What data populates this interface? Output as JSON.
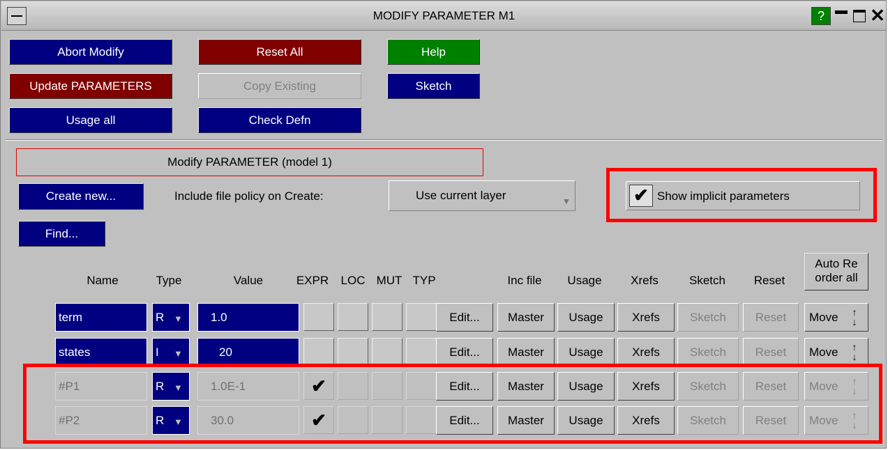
{
  "window": {
    "title": "MODIFY PARAMETER M1",
    "help_icon": "?",
    "minimize_icon": "minimize-icon",
    "restore_icon": "restore-icon",
    "close_icon": "close-icon"
  },
  "toolbar": {
    "abort_modify": "Abort Modify",
    "reset_all": "Reset All",
    "help": "Help",
    "update_parameters": "Update PARAMETERS",
    "copy_existing": "Copy Existing",
    "sketch": "Sketch",
    "usage_all": "Usage all",
    "check_defn": "Check Defn"
  },
  "section": {
    "title": "Modify PARAMETER (model 1)",
    "create_new": "Create new...",
    "include_policy_label": "Include file policy on Create:",
    "include_policy_value": "Use current layer",
    "show_implicit_label": "Show implicit parameters",
    "show_implicit_checked": true,
    "find": "Find..."
  },
  "table": {
    "headers": {
      "name": "Name",
      "type": "Type",
      "value": "Value",
      "expr": "EXPR",
      "loc": "LOC",
      "mut": "MUT",
      "typ": "TYP",
      "inc_file": "Inc file",
      "usage": "Usage",
      "xrefs": "Xrefs",
      "sketch": "Sketch",
      "reset": "Reset",
      "auto_reorder_line1": "Auto Re",
      "auto_reorder_line2": "order all"
    },
    "rows": [
      {
        "name": "term",
        "type": "R",
        "value": "1.0",
        "expr": false,
        "implicit": false,
        "edit": "Edit...",
        "inc_file": "Master",
        "usage": "Usage",
        "xrefs": "Xrefs",
        "sketch": "Sketch",
        "reset": "Reset",
        "move": "Move"
      },
      {
        "name": "states",
        "type": "I",
        "value": "20",
        "expr": false,
        "implicit": false,
        "edit": "Edit...",
        "inc_file": "Master",
        "usage": "Usage",
        "xrefs": "Xrefs",
        "sketch": "Sketch",
        "reset": "Reset",
        "move": "Move"
      },
      {
        "name": "#P1",
        "type": "R",
        "value": "1.0E-1",
        "expr": true,
        "implicit": true,
        "edit": "Edit...",
        "inc_file": "Master",
        "usage": "Usage",
        "xrefs": "Xrefs",
        "sketch": "Sketch",
        "reset": "Reset",
        "move": "Move"
      },
      {
        "name": "#P2",
        "type": "R",
        "value": "30.0",
        "expr": true,
        "implicit": true,
        "edit": "Edit...",
        "inc_file": "Master",
        "usage": "Usage",
        "xrefs": "Xrefs",
        "sketch": "Sketch",
        "reset": "Reset",
        "move": "Move"
      }
    ]
  },
  "colors": {
    "highlight": "#ff0000",
    "blue_button": "#000080",
    "red_button": "#800000",
    "green_button": "#008000",
    "panel": "#c0c0c0"
  }
}
